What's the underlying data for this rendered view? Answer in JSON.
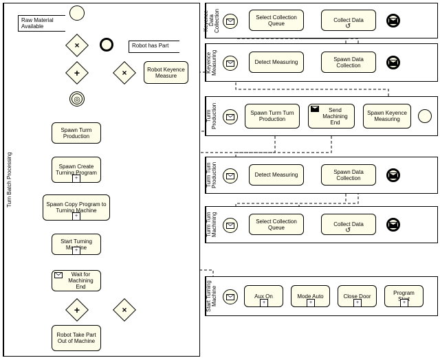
{
  "lanes": {
    "main": "Turn Batch\nProcessing",
    "l1": "Keyence\nData Collection",
    "l2": "Keyence\nMeasuring",
    "l3": "Turm\nProduction",
    "l4": "Turm Turn\nProduction",
    "l5": "Turm Turn\nMachining",
    "l6": "Start Turning\nMachine"
  },
  "annotations": {
    "raw": "Raw Material\nAvailable",
    "robot_part": "Robot has Part"
  },
  "tasks": {
    "robot_keyence": "Robot\nKeyence Measure",
    "spawn_turm_prod": "Spawn Turm\nProduction",
    "spawn_create": "Spawn Create\nTurning Program",
    "spawn_copy": "Spawn Copy Program to\nTurning Machine",
    "start_turning": "Start Turning\nMachine",
    "wait_end": "Wait for\nMachining End",
    "take_part": "Robot\nTake Part Out of\nMachine",
    "select_q1": "Select Collection\nQueue",
    "collect1": "Collect Data",
    "detect1": "Detect\nMeasuring",
    "spawn_dc1": "Spawn\nData Collection",
    "spawn_turn_prod": "Spawn Turm\nTurn Production",
    "send_end": "Send\nMachining End",
    "spawn_key_meas": "Spawn\nKeyence\nMeasuring",
    "detect2": "Detect\nMeasuring",
    "spawn_dc2": "Spawn\nData Collection",
    "select_q2": "Select Collection\nQueue",
    "collect2": "Collect Data",
    "aux": "Aux On",
    "mode": "Mode Auto",
    "close": "Close Door",
    "program": "Program\nStart"
  }
}
